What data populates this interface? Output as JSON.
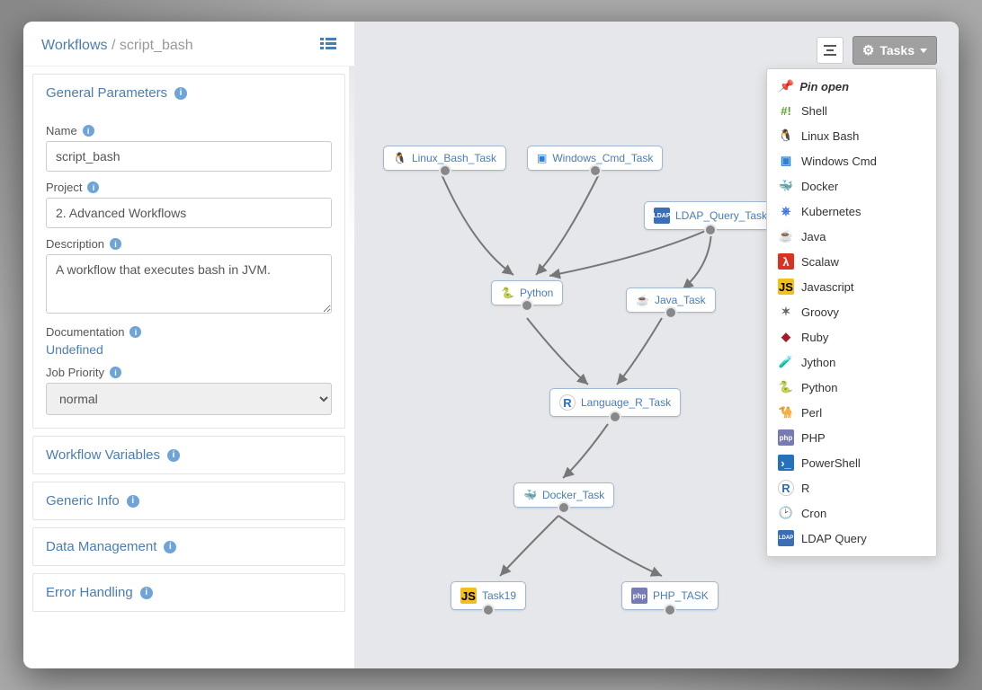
{
  "breadcrumb": {
    "root": "Workflows",
    "current": "script_bash"
  },
  "sections": {
    "general": {
      "title": "General Parameters",
      "name_label": "Name",
      "name_value": "script_bash",
      "project_label": "Project",
      "project_value": "2. Advanced Workflows",
      "desc_label": "Description",
      "desc_value": "A workflow that executes bash in JVM.",
      "doc_label": "Documentation",
      "doc_value": "Undefined",
      "priority_label": "Job Priority",
      "priority_value": "normal"
    },
    "variables": "Workflow Variables",
    "info": "Generic Info",
    "data": "Data Management",
    "error": "Error Handling"
  },
  "toolbar": {
    "tasks_label": "Tasks"
  },
  "dropdown": {
    "pin": "Pin open",
    "items": [
      {
        "label": "Shell",
        "icon": "hash",
        "color": "#5aa02c"
      },
      {
        "label": "Linux Bash",
        "icon": "tux",
        "color": "#000"
      },
      {
        "label": "Windows Cmd",
        "icon": "win",
        "color": "#2a7fd6"
      },
      {
        "label": "Docker",
        "icon": "dock",
        "color": "#2496ed"
      },
      {
        "label": "Kubernetes",
        "icon": "k8s",
        "color": "#326ce5"
      },
      {
        "label": "Java",
        "icon": "java",
        "color": "#c74634"
      },
      {
        "label": "Scalaw",
        "icon": "scala",
        "color": "#d73222"
      },
      {
        "label": "Javascript",
        "icon": "js",
        "color": "#f0c020"
      },
      {
        "label": "Groovy",
        "icon": "groovy",
        "color": "#666"
      },
      {
        "label": "Ruby",
        "icon": "ruby",
        "color": "#a8182a"
      },
      {
        "label": "Jython",
        "icon": "jy",
        "color": "#6aa84f"
      },
      {
        "label": "Python",
        "icon": "py",
        "color": "#3776ab"
      },
      {
        "label": "Perl",
        "icon": "perl",
        "color": "#000"
      },
      {
        "label": "PHP",
        "icon": "php",
        "color": "#777bb3"
      },
      {
        "label": "PowerShell",
        "icon": "ps",
        "color": "#2671be"
      },
      {
        "label": "R",
        "icon": "r",
        "color": "#276dc3"
      },
      {
        "label": "Cron",
        "icon": "cron",
        "color": "#000"
      },
      {
        "label": "LDAP Query",
        "icon": "ldap",
        "color": "#3a6fb5"
      }
    ]
  },
  "nodes": {
    "linux": "Linux_Bash_Task",
    "win": "Windows_Cmd_Task",
    "ldap": "LDAP_Query_Task",
    "python": "Python",
    "java": "Java_Task",
    "r": "Language_R_Task",
    "docker": "Docker_Task",
    "js": "Task19",
    "php": "PHP_TASK"
  }
}
